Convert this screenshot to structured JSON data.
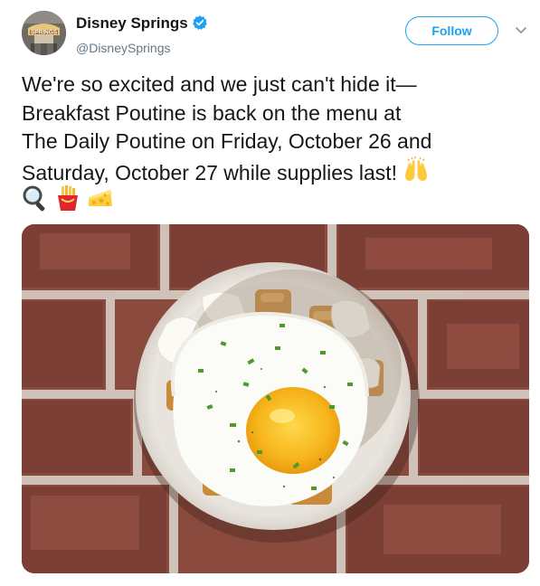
{
  "author": {
    "display_name": "Disney Springs",
    "handle": "@DisneySprings",
    "verified": true,
    "avatar_icon": "disney-springs-water-tower-logo",
    "avatar_text": "SPRINGS"
  },
  "actions": {
    "follow_label": "Follow",
    "menu_icon": "chevron-down-icon"
  },
  "tweet": {
    "text": "We're so excited and we just can't hide it—\nBreakfast Poutine is back on the menu at\nThe Daily Poutine on Friday, October 26 and\nSaturday, October 27 while supplies last!",
    "trailing_emoji": "raising-hands-icon",
    "emojis": [
      "magnifying-glass-icon",
      "french-fries-icon",
      "cheese-wedge-icon"
    ]
  },
  "media": {
    "type": "photo",
    "subject": "breakfast-poutine-bowl"
  },
  "colors": {
    "accent": "#1da1f2",
    "text": "#14171a",
    "secondary": "#657786"
  }
}
